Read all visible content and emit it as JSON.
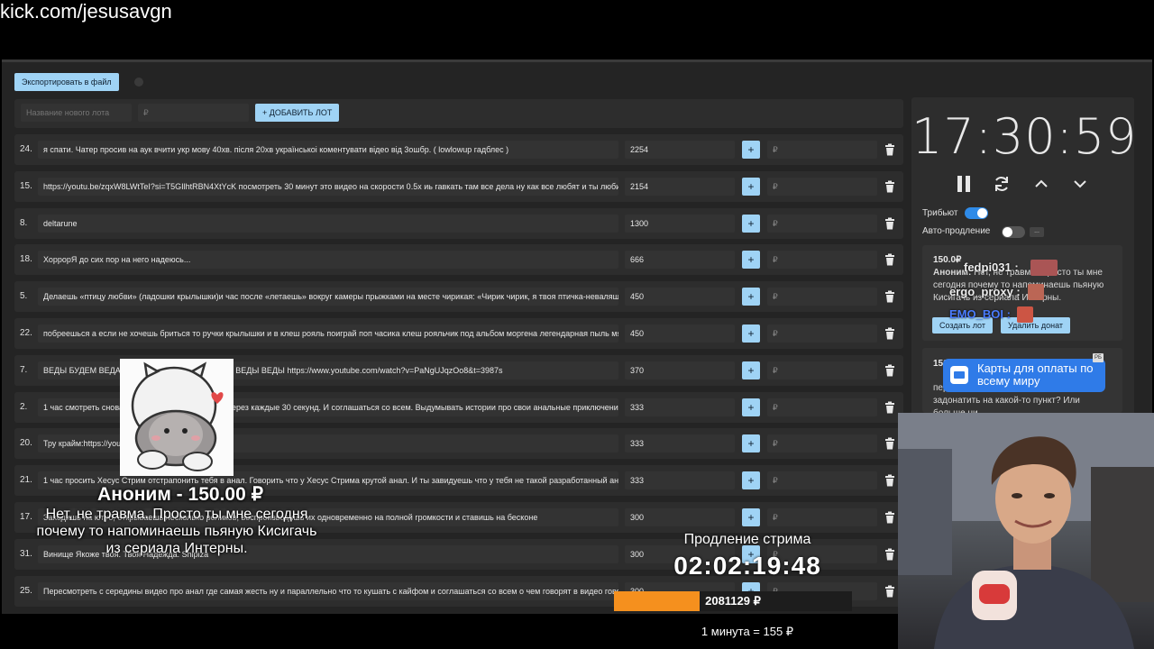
{
  "url": "kick.com/jesusavgn",
  "toolbar": {
    "export_label": "Экспортировать в файл"
  },
  "new_lot": {
    "name_placeholder": "Название нового лота",
    "amount_placeholder": "₽",
    "add_label": "+ ДОБАВИТЬ ЛОТ"
  },
  "lots": [
    {
      "num": "24.",
      "title": "я спати. Чатер просив на аук вчити укр мову 40хв. після 20хв українськоі коментувати відео від 3ошбр. ( lowlowup гадблес )",
      "amount": "2254",
      "rub": "₽"
    },
    {
      "num": "15.",
      "title": "https://youtu.be/zqxW8LWtTeI?si=T5GIlhtRBN4XtYcK посмотреть 30 минут это видео на скорости 0.5х иь гавкать там все дела ну как все любят и ты люби",
      "amount": "2154",
      "rub": "₽"
    },
    {
      "num": "8.",
      "title": "deltarune",
      "amount": "1300",
      "rub": "₽"
    },
    {
      "num": "18.",
      "title": "ХоррорЯ до сих пор на него надеюсь...",
      "amount": "666",
      "rub": "₽"
    },
    {
      "num": "5.",
      "title": "Делаешь «птицу любви» (ладошки крылышки)и час после «летаешь» вокруг камеры прыжками на месте чирикая: «Чирик чирик, я твоя птичка-неваляшка",
      "amount": "450",
      "rub": "₽"
    },
    {
      "num": "22.",
      "title": "побреешься а если не хочешь бриться то ручки крылышки и в клеш рояль поиграй поп часика клеш рояльчик под альбом моргена легендарная пыль мя",
      "amount": "450",
      "rub": "₽"
    },
    {
      "num": "7.",
      "title": "ВЕДЫ БУДЕМ ВЕДАТЬ ВЕДЫ ВЕДЫ ВЕДЫ ВЕДЫ ВЕДЫ ВЕДЫ https://www.youtube.com/watch?v=PaNgUJqzOo8&t=3987s",
      "amount": "370",
      "rub": "₽"
    },
    {
      "num": "2.",
      "title": "1 час смотреть снова вместе с чатом и говорить через каждые 30 секунд. И соглашаться со всем. Выдумывать истории про свои анальные приключени",
      "amount": "333",
      "rub": "₽"
    },
    {
      "num": "20.",
      "title": "Тру крайм:https://youtu.be/watch?v=F3lpdC-RCiT",
      "amount": "333",
      "rub": "₽"
    },
    {
      "num": "21.",
      "title": "1 час просить Хесус Стрим отстрапонить тебя в анал. Говорить что у Хесус Стрима крутой анал. И ты завидуешь что у тебя не такой разработанный ана",
      "amount": "333",
      "rub": "₽"
    },
    {
      "num": "17.",
      "title": "Заходишь на ютуб, открываешь несколько роликов, воспроизводишь их одновременно на полной громкости и ставишь на бесконе",
      "amount": "300",
      "rub": "₽"
    },
    {
      "num": "31.",
      "title": "Винище Якоже твоя. Твоя Надежда. Shipiza",
      "amount": "300",
      "rub": "₽"
    },
    {
      "num": "25.",
      "title": "Пересмотреть с середины видео про анал где самая жесть ну и параллельно что то кушать с кайфом и соглашаться со всем о чем говорят в видео гово",
      "amount": "300",
      "rub": "₽"
    }
  ],
  "timer": {
    "clock": "17:30:59"
  },
  "toggles": {
    "tribute_label": "Трибьют",
    "auto_label": "Авто-продление",
    "dots": "..."
  },
  "donation_card": {
    "amount": "150.0₽",
    "author": "Аноним:",
    "text": "Нет, не травма. Просто ты мне сегодня почему то напоминаешь пьяную Кисигачь из сериала Интерны.",
    "create_label": "Создать лот",
    "delete_label": "Удалить донат"
  },
  "donation_card2": {
    "amount": "150",
    "text": "пер… донатов на фон. Можно же задонатить на какой-то пункт? Или больше ни…"
  },
  "chat": [
    {
      "user": "fedpi031 :",
      "color": "#d8d8d8"
    },
    {
      "user": "ergo_proxy :",
      "color": "#e8e8e8"
    },
    {
      "user": "EMO_BOI :",
      "color": "#4a7cff"
    }
  ],
  "ad": {
    "text": "Карты для оплаты по всему миру",
    "badge": "РБ"
  },
  "donation_alert": {
    "name": "Аноним - 150.00 ₽",
    "message": "Нет, не травма. Просто ты мне сегодня почему то напоминаешь пьяную Кисигачь из сериала Интерны."
  },
  "extension": {
    "label": "Продление стрима",
    "timer": "02:02:19:48",
    "total": "2081129 ₽",
    "progress_percent": 36,
    "rate": "1 минута = 155 ₽"
  },
  "colors": {
    "accent": "#9fd3f5",
    "toggle_on": "#2f8be8",
    "progress": "#f5901e"
  }
}
